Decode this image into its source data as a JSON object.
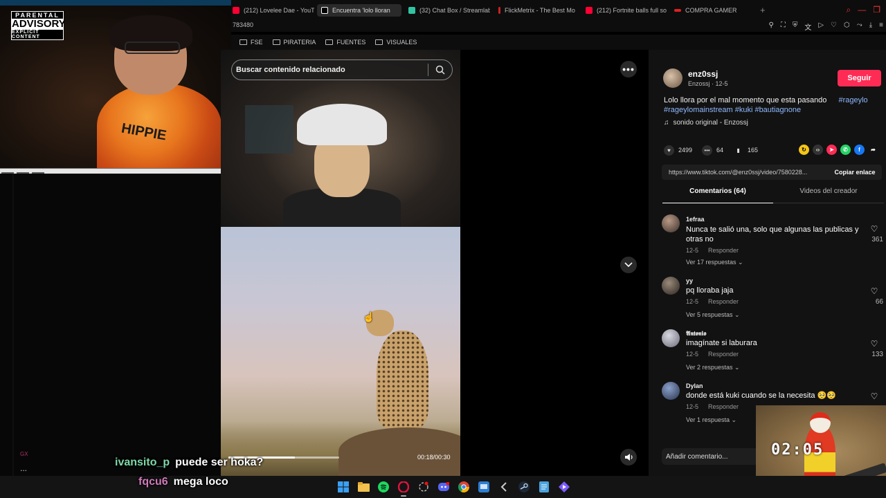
{
  "stream": {
    "advisory_line1": "PARENTAL",
    "advisory_line2": "ADVISORY",
    "advisory_line3": "EXPLICIT CONTENT",
    "shirt_text": "HIPPIE",
    "gx_label": "GX",
    "dots_label": "..."
  },
  "tabs": [
    {
      "label": "(212) Lovelee Dae - YouTu",
      "icon": "youtube-icon",
      "color": "#ff0033"
    },
    {
      "label": "Encuentra 'lolo lloran",
      "icon": "tiktok-icon",
      "color": "#ffffff"
    },
    {
      "label": "(32) Chat Box / Streamlab",
      "icon": "streamlabs-icon",
      "color": "#31c3a2"
    },
    {
      "label": "FlickMetrix - The Best Mo",
      "icon": "flickmetrix-icon",
      "color": "#cc2222"
    },
    {
      "label": "(212) Fortnite balls full so",
      "icon": "youtube-icon",
      "color": "#ff0033"
    },
    {
      "label": "COMPRA GAMER",
      "icon": "compragamer-icon",
      "color": "#e02020"
    }
  ],
  "url_text": "783480",
  "bookmarks": [
    "FSE",
    "PIRATERIA",
    "FUENTES",
    "VISUALES"
  ],
  "search": {
    "placeholder": "Buscar contenido relacionado"
  },
  "video": {
    "time": "00:18/00:30",
    "progress": 0.6
  },
  "post": {
    "author": "enz0ssj",
    "meta": "Enzossj · 12-5",
    "follow_label": "Seguir",
    "desc_text": "Lolo llora por el mal momento que esta pasando",
    "tag1": "#rageylo",
    "tags_line": "#rageylomainstream #kuki #bautiagnone",
    "sound": "sonido original - Enzossj",
    "likes": "2499",
    "comments": "64",
    "saves": "165",
    "link": "https://www.tiktok.com/@enz0ssj/video/7580228...",
    "copy_label": "Copiar enlace",
    "tab_comments": "Comentarios (64)",
    "tab_videos": "Videos del creador",
    "comment_placeholder": "Añadir comentario..."
  },
  "comments": [
    {
      "user": "1efraa",
      "text": "Nunca te salió una, solo que algunas las publicas y otras no",
      "date": "12-5",
      "reply": "Responder",
      "replies": "Ver 17 respuestas",
      "likes": "361"
    },
    {
      "user": "yy",
      "text": "pq lloraba jaja",
      "date": "12-5",
      "reply": "Responder",
      "replies": "Ver 5 respuestas",
      "likes": "66"
    },
    {
      "user": "𝕬𝖓𝖙𝖔𝖓𝖎𝖔",
      "text": "imagínate si laburara",
      "date": "12-5",
      "reply": "Responder",
      "replies": "Ver 2 respuestas",
      "likes": "133"
    },
    {
      "user": "Dylan",
      "text": "donde está kuki cuando se la necesita 🥺🥺",
      "date": "12-5",
      "reply": "Responder",
      "replies": "Ver 1 respuesta",
      "likes": ""
    }
  ],
  "game": {
    "timer": "02:05"
  },
  "chat": [
    {
      "user": "ivansito_p",
      "message": "puede ser hoka?",
      "color": "#7fd8a8"
    },
    {
      "user": "fqcu6",
      "message": "mega loco",
      "color": "#d07ab8"
    }
  ],
  "taskbar": [
    "windows-icon",
    "file-explorer-icon",
    "spotify-icon",
    "opera-gx-icon",
    "steam-settings-icon",
    "discord-icon",
    "chrome-icon",
    "remote-desktop-icon",
    "wave-icon",
    "steam-icon",
    "notepad-icon",
    "launcher-icon"
  ]
}
